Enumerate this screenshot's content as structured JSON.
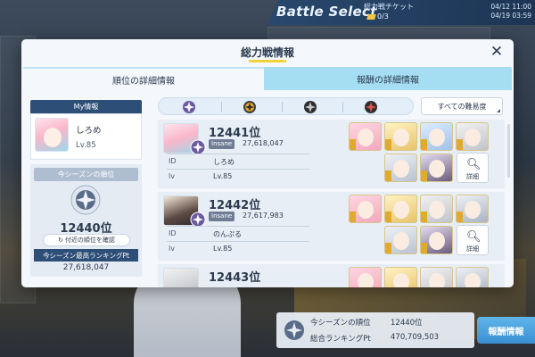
{
  "background": {
    "banner_title": "Battle Select",
    "ticket_label": "総力戦チケット",
    "ticket_count": "0/3",
    "dates": [
      "04/12 11:00",
      "04/19 03:59"
    ],
    "bottom_info": {
      "season_rank_label": "今シーズンの順位",
      "season_rank_value": "12440位",
      "total_pt_label": "総合ランキングPt",
      "total_pt_value": "470,709,503"
    },
    "reward_button": "報酬情報"
  },
  "modal": {
    "title": "総力戦情報",
    "close_icon": "close-icon",
    "tabs": [
      {
        "label": "順位の詳細情報",
        "active": true
      },
      {
        "label": "報酬の詳細情報",
        "active": false
      }
    ],
    "my_info": {
      "header": "My情報",
      "name": "しろめ",
      "level": "Lv.85"
    },
    "season": {
      "header": "今シーズンの順位",
      "rank": "12440位",
      "nearby_button": "付近の順位を確認",
      "best_header": "今シーズン最高ランキングPt",
      "best_value": "27,618,047"
    },
    "difficulty_filter": {
      "options": [
        "difficulty-1-icon",
        "difficulty-2-icon",
        "difficulty-3-icon",
        "difficulty-4-icon"
      ],
      "all_label": "すべての難易度"
    },
    "ranking": [
      {
        "rank": "12441位",
        "difficulty": "Insane",
        "score": "27,618,047",
        "id_label": "ID",
        "id": "しろめ",
        "lv_label": "lv",
        "lv": "Lv.85",
        "detail_label": "詳細"
      },
      {
        "rank": "12442位",
        "difficulty": "Insane",
        "score": "27,617,983",
        "id_label": "ID",
        "id": "のんぷる",
        "lv_label": "lv",
        "lv": "Lv.85",
        "detail_label": "詳細"
      },
      {
        "rank": "12443位"
      }
    ]
  },
  "colors": {
    "navy": "#2d4e77",
    "tab_active_border": "#bfe4f6",
    "tab_inactive": "#a5ddf2",
    "accent_yellow": "#f4d23a",
    "reward_button": "#3b8fd2"
  }
}
